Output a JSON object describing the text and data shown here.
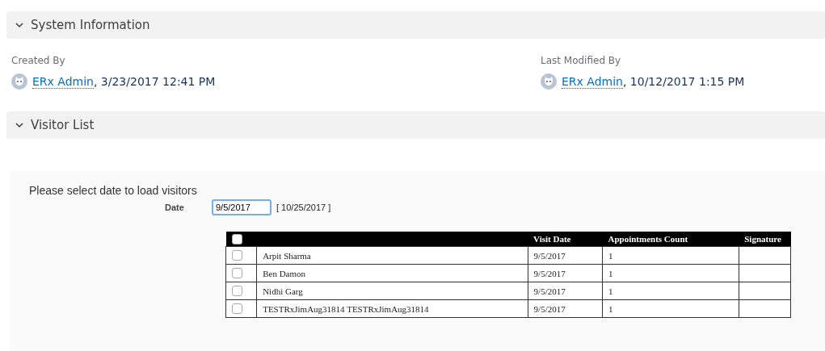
{
  "sections": [
    {
      "title": "System Information",
      "expanded": true
    },
    {
      "title": "Visitor List",
      "expanded": true
    }
  ],
  "fields": [
    {
      "label": "Created By",
      "user": "ERx Admin",
      "date": ", 3/23/2017 12:41 PM"
    },
    {
      "label": "Last Modified By",
      "user": "ERx Admin",
      "date": ", 10/12/2017 1:15 PM"
    }
  ],
  "visitors": {
    "prompt": "Please select date to load visitors",
    "date_label": "Date",
    "date_value": "9/5/2017",
    "today": "[ 10/25/2017 ]",
    "table": {
      "select_all_checked": false,
      "columns": [
        "Visit Date",
        "Appointments Count",
        "Signature"
      ],
      "rows": [
        {
          "checked": false,
          "name": "Arpit Sharma",
          "visit_date": "9/5/2017",
          "count": "1"
        },
        {
          "checked": false,
          "name": "Ben Damon",
          "visit_date": "9/5/2017",
          "count": "1"
        },
        {
          "checked": false,
          "name": "Nidhi Garg",
          "visit_date": "9/5/2017",
          "count": "1"
        },
        {
          "checked": false,
          "name": "TESTRxJimAug31814 TESTRxJimAug31814",
          "visit_date": "9/5/2017",
          "count": "1"
        }
      ]
    }
  }
}
